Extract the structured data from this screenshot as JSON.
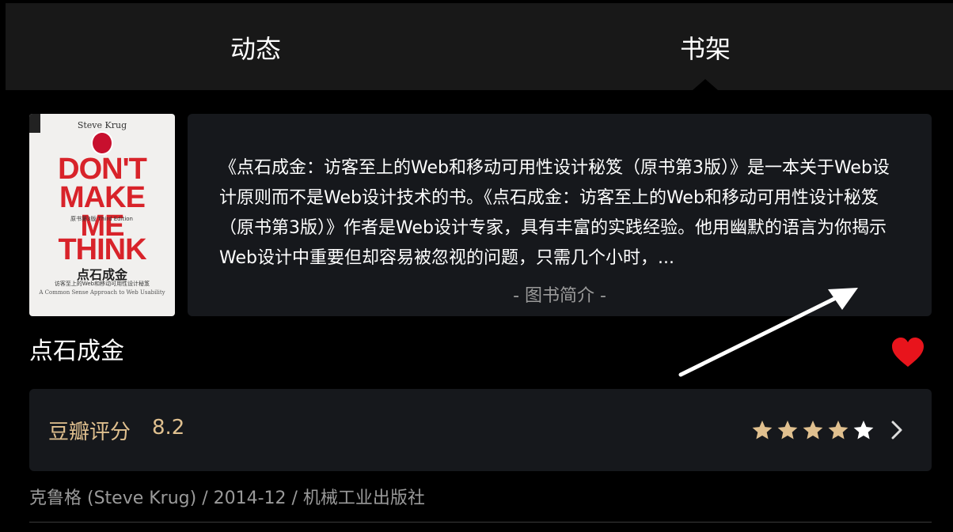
{
  "tabs": [
    {
      "label": "动态"
    },
    {
      "label": "书架"
    }
  ],
  "cover": {
    "author": "Steve Krug",
    "line1": "DON'T",
    "line2": "MAKE",
    "line3": "ME",
    "line4": "THINK",
    "edition": "原书第3版 Third Edition",
    "cn_title": "点石成金",
    "cn_subtitle": "访客至上的Web和移动可用性设计秘笈",
    "en_subtitle": "A Common Sense Approach to Web Usability"
  },
  "description": {
    "text": "《点石成金：访客至上的Web和移动可用性设计秘笈（原书第3版）》是一本关于Web设计原则而不是Web设计技术的书。《点石成金：访客至上的Web和移动可用性设计秘笈（原书第3版）》作者是Web设计专家，具有丰富的实践经验。他用幽默的语言为你揭示Web设计中重要但却容易被忽视的问题，只需几个小时，...",
    "footer": "- 图书简介 -"
  },
  "book": {
    "title": "点石成金"
  },
  "rating": {
    "label": "豆瓣评分",
    "score": "8.2",
    "stars_filled": 4,
    "stars_total": 5,
    "star_color": "#e0c08f"
  },
  "meta": {
    "text": "克鲁格 (Steve Krug) / 2014-12 / 机械工业出版社"
  },
  "colors": {
    "background": "#000000",
    "header": "#181818",
    "card": "#16181c",
    "heart": "#e8141c",
    "accent": "#e0c08f"
  }
}
